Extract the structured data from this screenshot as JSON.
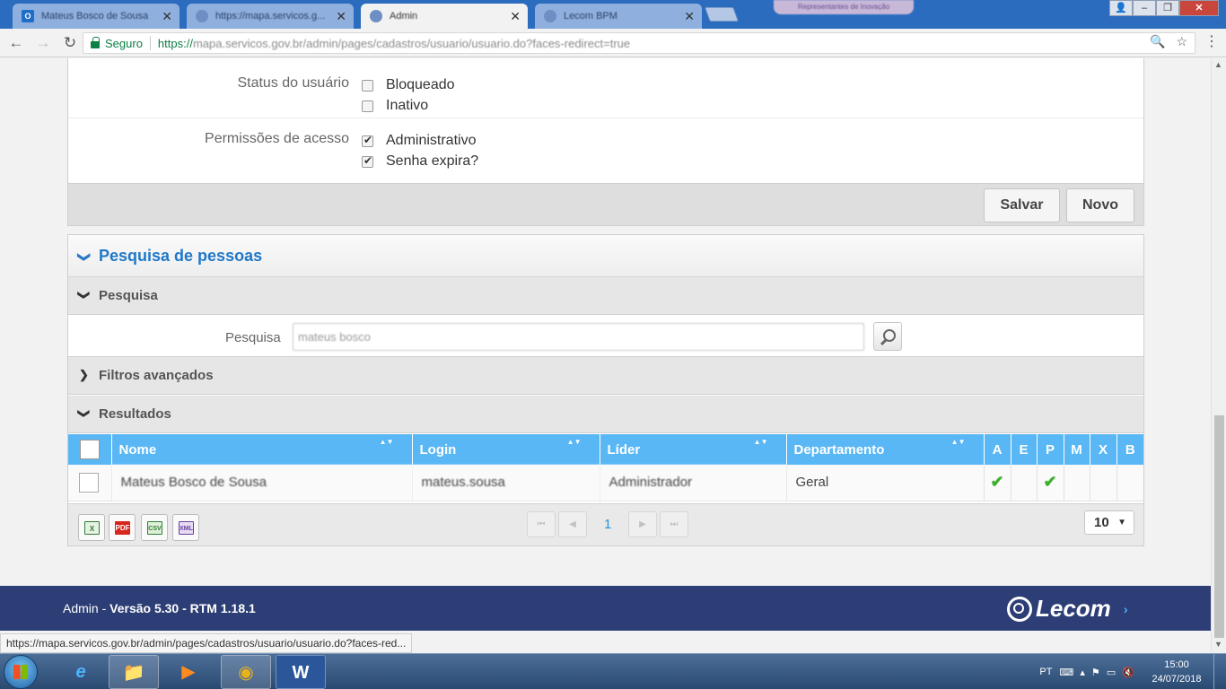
{
  "browser": {
    "tabs": [
      {
        "label": "Mateus Bosco de Sousa",
        "active": false
      },
      {
        "label": "https://mapa.servicos.g...",
        "active": false
      },
      {
        "label": "Admin",
        "active": true
      },
      {
        "label": "Lecom BPM",
        "active": false
      }
    ],
    "tab_close": "✕",
    "promo": "Representantes de Inovação",
    "window_controls": {
      "user": "👤",
      "minimize": "–",
      "maximize": "❐",
      "close": "✕"
    },
    "nav": {
      "back": "←",
      "forward": "→",
      "reload": "↻"
    },
    "security_label": "Seguro",
    "url_scheme": "https://",
    "url_rest": "mapa.servicos.gov.br/admin/pages/cadastros/usuario/usuario.do?faces-redirect=true",
    "zoom_icon": "🔍",
    "star_icon": "☆",
    "menu_icon": "⋮"
  },
  "scrollbar": {
    "up": "▲",
    "down": "▼"
  },
  "user_form": {
    "status": {
      "label": "Status do usuário",
      "options": [
        {
          "label": "Bloqueado",
          "checked": false
        },
        {
          "label": "Inativo",
          "checked": false
        }
      ]
    },
    "permissions": {
      "label": "Permissões de acesso",
      "options": [
        {
          "label": "Administrativo",
          "checked": true
        },
        {
          "label": "Senha expira?",
          "checked": true
        }
      ]
    },
    "buttons": {
      "save": "Salvar",
      "new": "Novo"
    }
  },
  "search_panel": {
    "title": "Pesquisa de pessoas",
    "search_section": "Pesquisa",
    "search_label": "Pesquisa",
    "search_value": "mateus bosco",
    "advanced_filters": "Filtros avançados",
    "results_section": "Resultados",
    "chevron_open": "❯",
    "chevron_closed": "❯",
    "sort_icon": "▲▼"
  },
  "results": {
    "columns": [
      "Nome",
      "Login",
      "Líder",
      "Departamento"
    ],
    "flag_columns": [
      "A",
      "E",
      "P",
      "M",
      "X",
      "B"
    ],
    "rows": [
      {
        "nome": "Mateus Bosco de Sousa",
        "login": "mateus.sousa",
        "lider": "Administrador",
        "departamento": "Geral",
        "flags": {
          "A": "✔",
          "E": "",
          "P": "✔",
          "M": "",
          "X": "",
          "B": ""
        }
      }
    ],
    "export": [
      "X",
      "PDF",
      "CSV",
      "XML"
    ],
    "pager": {
      "first": "⏮",
      "prev": "◀",
      "current": "1",
      "next": "▶",
      "last": "⏭"
    },
    "rows_per_page": "10",
    "rows_per_page_caret": "▼"
  },
  "footer": {
    "app": "Admin",
    "dash": " - ",
    "version": "Versão 5.30 - RTM 1.18.1",
    "logo_text": "Lecom",
    "logo_arrow": "›"
  },
  "status_url": "https://mapa.servicos.gov.br/admin/pages/cadastros/usuario/usuario.do?faces-red...",
  "taskbar": {
    "apps": [
      {
        "name": "internet-explorer",
        "glyph": "e"
      },
      {
        "name": "file-explorer",
        "glyph": "📁"
      },
      {
        "name": "media-player",
        "glyph": "▶"
      },
      {
        "name": "chrome",
        "glyph": "◉"
      },
      {
        "name": "word",
        "glyph": "W"
      }
    ],
    "lang": "PT",
    "tray_icons": "⌨ ▴ ⚑ ▭ 🔇",
    "time": "15:00",
    "date": "24/07/2018"
  },
  "colors": {
    "accent": "#1f78c9",
    "grid_header": "#5ab7f5",
    "footer": "#2c3e75",
    "check": "#3caf2c"
  }
}
